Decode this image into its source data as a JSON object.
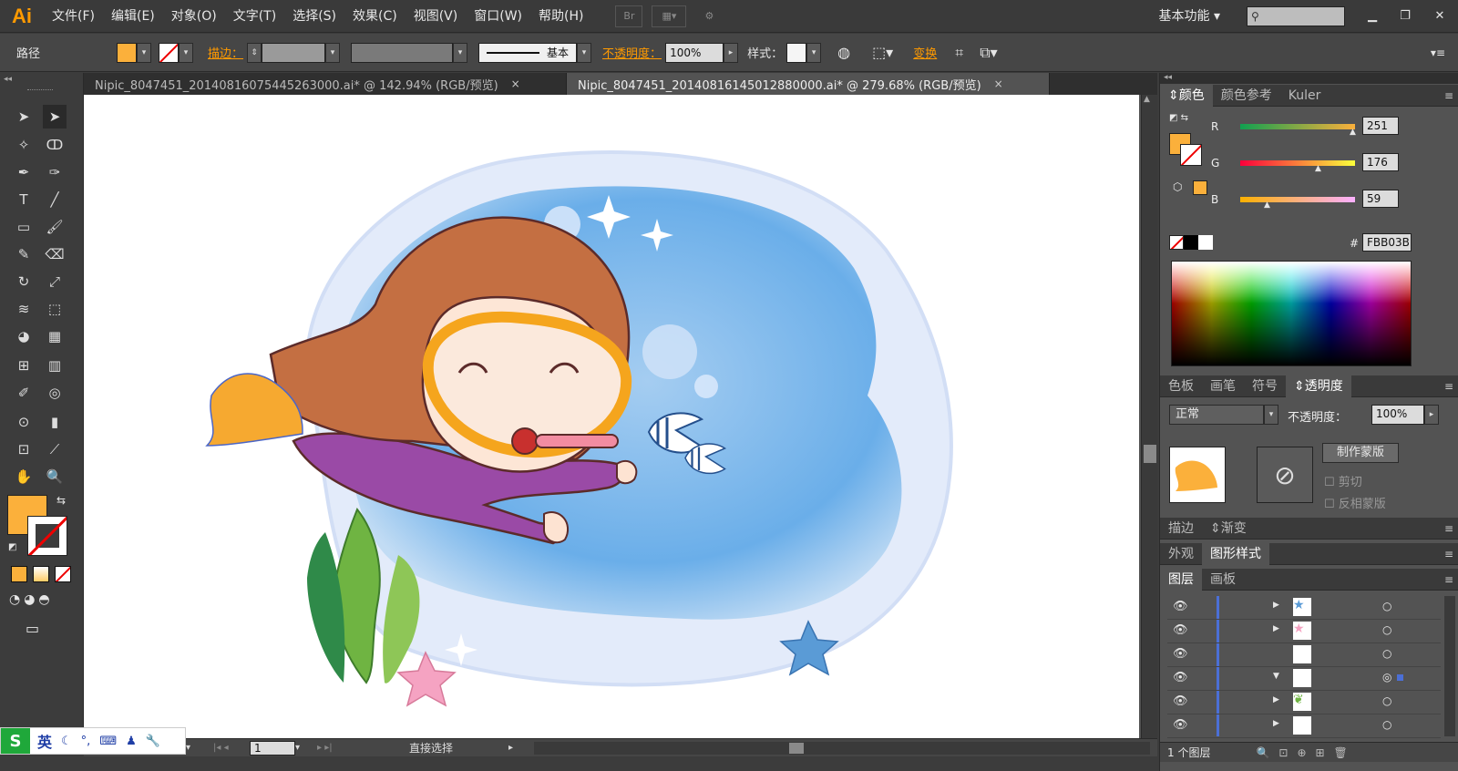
{
  "app": {
    "logo": "Ai",
    "workspace": "基本功能"
  },
  "menu": [
    "文件(F)",
    "编辑(E)",
    "对象(O)",
    "文字(T)",
    "选择(S)",
    "效果(C)",
    "视图(V)",
    "窗口(W)",
    "帮助(H)"
  ],
  "toolbar_icons": {
    "bridge": "Br"
  },
  "control": {
    "object_type": "路径",
    "fill_color": "#FBB03B",
    "stroke_label": "描边",
    "stroke_style": "基本",
    "opacity_label": "不透明度",
    "opacity_value": "100%",
    "style_label": "样式",
    "transform_label": "变换"
  },
  "tabs": [
    {
      "label": "Nipic_8047451_20140816075445263000.ai* @ 142.94% (RGB/预览)",
      "close": "×"
    },
    {
      "label": "Nipic_8047451_20140816145012880000.ai* @ 279.68% (RGB/预览)",
      "close": "×"
    }
  ],
  "color_panel": {
    "tabs": [
      "颜色",
      "颜色参考",
      "Kuler"
    ],
    "r_label": "R",
    "r": "251",
    "g_label": "G",
    "g": "176",
    "b_label": "B",
    "b": "59",
    "hex_label": "#",
    "hex": "FBB03B"
  },
  "transparency_panel": {
    "tabs": [
      "色板",
      "画笔",
      "符号",
      "透明度"
    ],
    "blend": "正常",
    "opacity_label": "不透明度：",
    "opacity": "100%",
    "make_mask": "制作蒙版",
    "clip": "剪切",
    "invert": "反相蒙版"
  },
  "stroke_panel": {
    "tabs": [
      "描边",
      "渐变"
    ]
  },
  "appearance_panel": {
    "tabs": [
      "外观",
      "图形样式"
    ]
  },
  "layers_panel": {
    "tabs": [
      "图层",
      "画板"
    ],
    "count_label": "1 个图层"
  },
  "status": {
    "zoom_field": "1",
    "tool": "直接选择"
  },
  "ime": {
    "lang": "英"
  },
  "colors": {
    "accent": "#ff9a00",
    "fill": "#FBB03B",
    "ui_bg": "#535353"
  }
}
